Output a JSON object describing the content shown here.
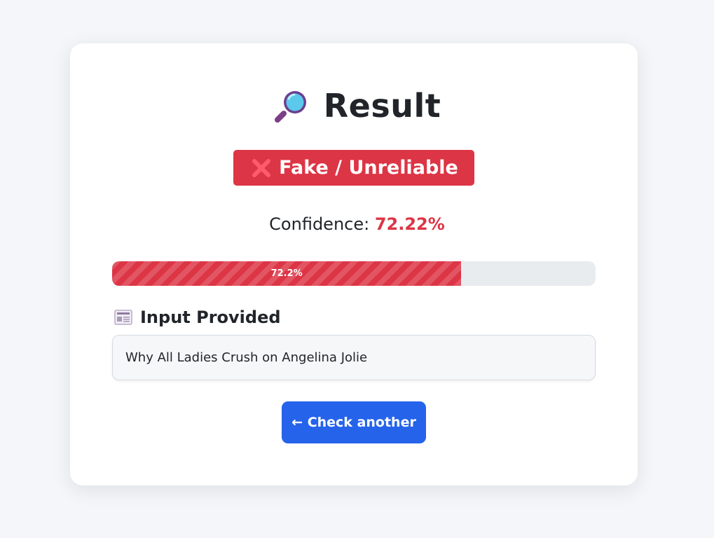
{
  "result": {
    "title": "Result",
    "title_icon": "magnifying-glass-icon",
    "verdict_icon": "cross-mark-icon",
    "verdict_label": "Fake / Unreliable",
    "verdict_color": "#dc3545",
    "confidence_label": "Confidence:",
    "confidence_value": "72.22%",
    "progress_label": "72.2%",
    "progress_fraction": 0.7222
  },
  "input_section": {
    "icon": "newspaper-icon",
    "heading": "Input Provided",
    "text": "Why All Ladies Crush on Angelina Jolie"
  },
  "actions": {
    "check_another_label": "← Check another",
    "button_color": "#2563eb"
  }
}
